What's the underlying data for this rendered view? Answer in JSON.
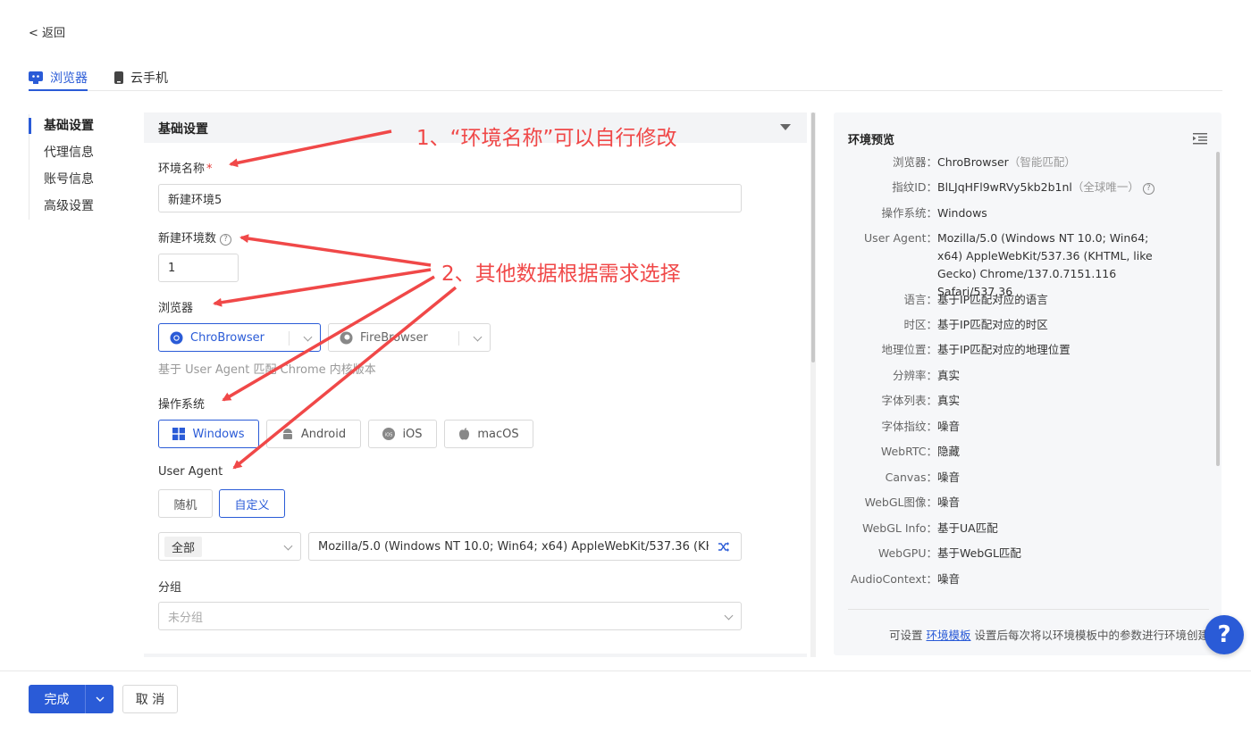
{
  "back": {
    "label": "< 返回"
  },
  "top_tabs": [
    {
      "label": "浏览器",
      "icon": "browser-monitor-icon",
      "active": true
    },
    {
      "label": "云手机",
      "icon": "phone-icon",
      "active": false
    }
  ],
  "left_nav": [
    {
      "label": "基础设置",
      "active": true
    },
    {
      "label": "代理信息"
    },
    {
      "label": "账号信息"
    },
    {
      "label": "高级设置"
    }
  ],
  "section": {
    "title": "基础设置"
  },
  "form": {
    "env_name": {
      "label": "环境名称",
      "required_mark": "*",
      "value": "新建环境5"
    },
    "env_count": {
      "label": "新建环境数",
      "value": "1"
    },
    "browser": {
      "label": "浏览器",
      "options": [
        {
          "label": "ChroBrowser",
          "selected": true
        },
        {
          "label": "FireBrowser",
          "selected": false
        }
      ],
      "hint": "基于 User Agent 匹配 Chrome 内核版本"
    },
    "os": {
      "label": "操作系统",
      "options": [
        {
          "label": "Windows",
          "selected": true
        },
        {
          "label": "Android",
          "selected": false
        },
        {
          "label": "iOS",
          "selected": false
        },
        {
          "label": "macOS",
          "selected": false
        }
      ]
    },
    "user_agent": {
      "label": "User Agent",
      "modes": [
        {
          "label": "随机",
          "selected": false
        },
        {
          "label": "自定义",
          "selected": true
        }
      ],
      "filter_value": "全部",
      "value": "Mozilla/5.0 (Windows NT 10.0; Win64; x64) AppleWebKit/537.36 (KH"
    },
    "group": {
      "label": "分组",
      "placeholder": "未分组"
    }
  },
  "preview": {
    "title": "环境预览",
    "rows": [
      {
        "key": "浏览器：",
        "value": "ChroBrowser",
        "note": "（智能匹配）"
      },
      {
        "key": "指纹ID：",
        "value": "BlLJqHFl9wRVy5kb2b1nl",
        "note": "（全球唯一）"
      },
      {
        "key": "操作系统：",
        "value": "Windows"
      },
      {
        "key": "User Agent：",
        "value": "Mozilla/5.0 (Windows NT 10.0; Win64; x64) AppleWebKit/537.36 (KHTML, like Gecko) Chrome/137.0.7151.116 Safari/537.36"
      },
      {
        "key": "语言：",
        "value": "基于IP匹配对应的语言"
      },
      {
        "key": "时区：",
        "value": "基于IP匹配对应的时区"
      },
      {
        "key": "地理位置：",
        "value": "基于IP匹配对应的地理位置"
      },
      {
        "key": "分辨率：",
        "value": "真实"
      },
      {
        "key": "字体列表：",
        "value": "真实"
      },
      {
        "key": "字体指纹：",
        "value": "噪音"
      },
      {
        "key": "WebRTC：",
        "value": "隐藏"
      },
      {
        "key": "Canvas：",
        "value": "噪音"
      },
      {
        "key": "WebGL图像：",
        "value": "噪音"
      },
      {
        "key": "WebGL Info：",
        "value": "基于UA匹配"
      },
      {
        "key": "WebGPU：",
        "value": "基于WebGL匹配"
      },
      {
        "key": "AudioContext：",
        "value": "噪音"
      }
    ],
    "footer": {
      "prefix": "可设置 ",
      "link": "环境模板",
      "suffix": " 设置后每次将以环境模板中的参数进行环境创建"
    }
  },
  "actions": {
    "confirm": "完成",
    "cancel": "取 消"
  },
  "help_fab": "?",
  "annotations": {
    "note1": "1、“环境名称”可以自行修改",
    "note2": "2、其他数据根据需求选择",
    "color": "#f04848"
  },
  "colors": {
    "accent": "#2a5bd7",
    "annotation": "#f04848"
  }
}
